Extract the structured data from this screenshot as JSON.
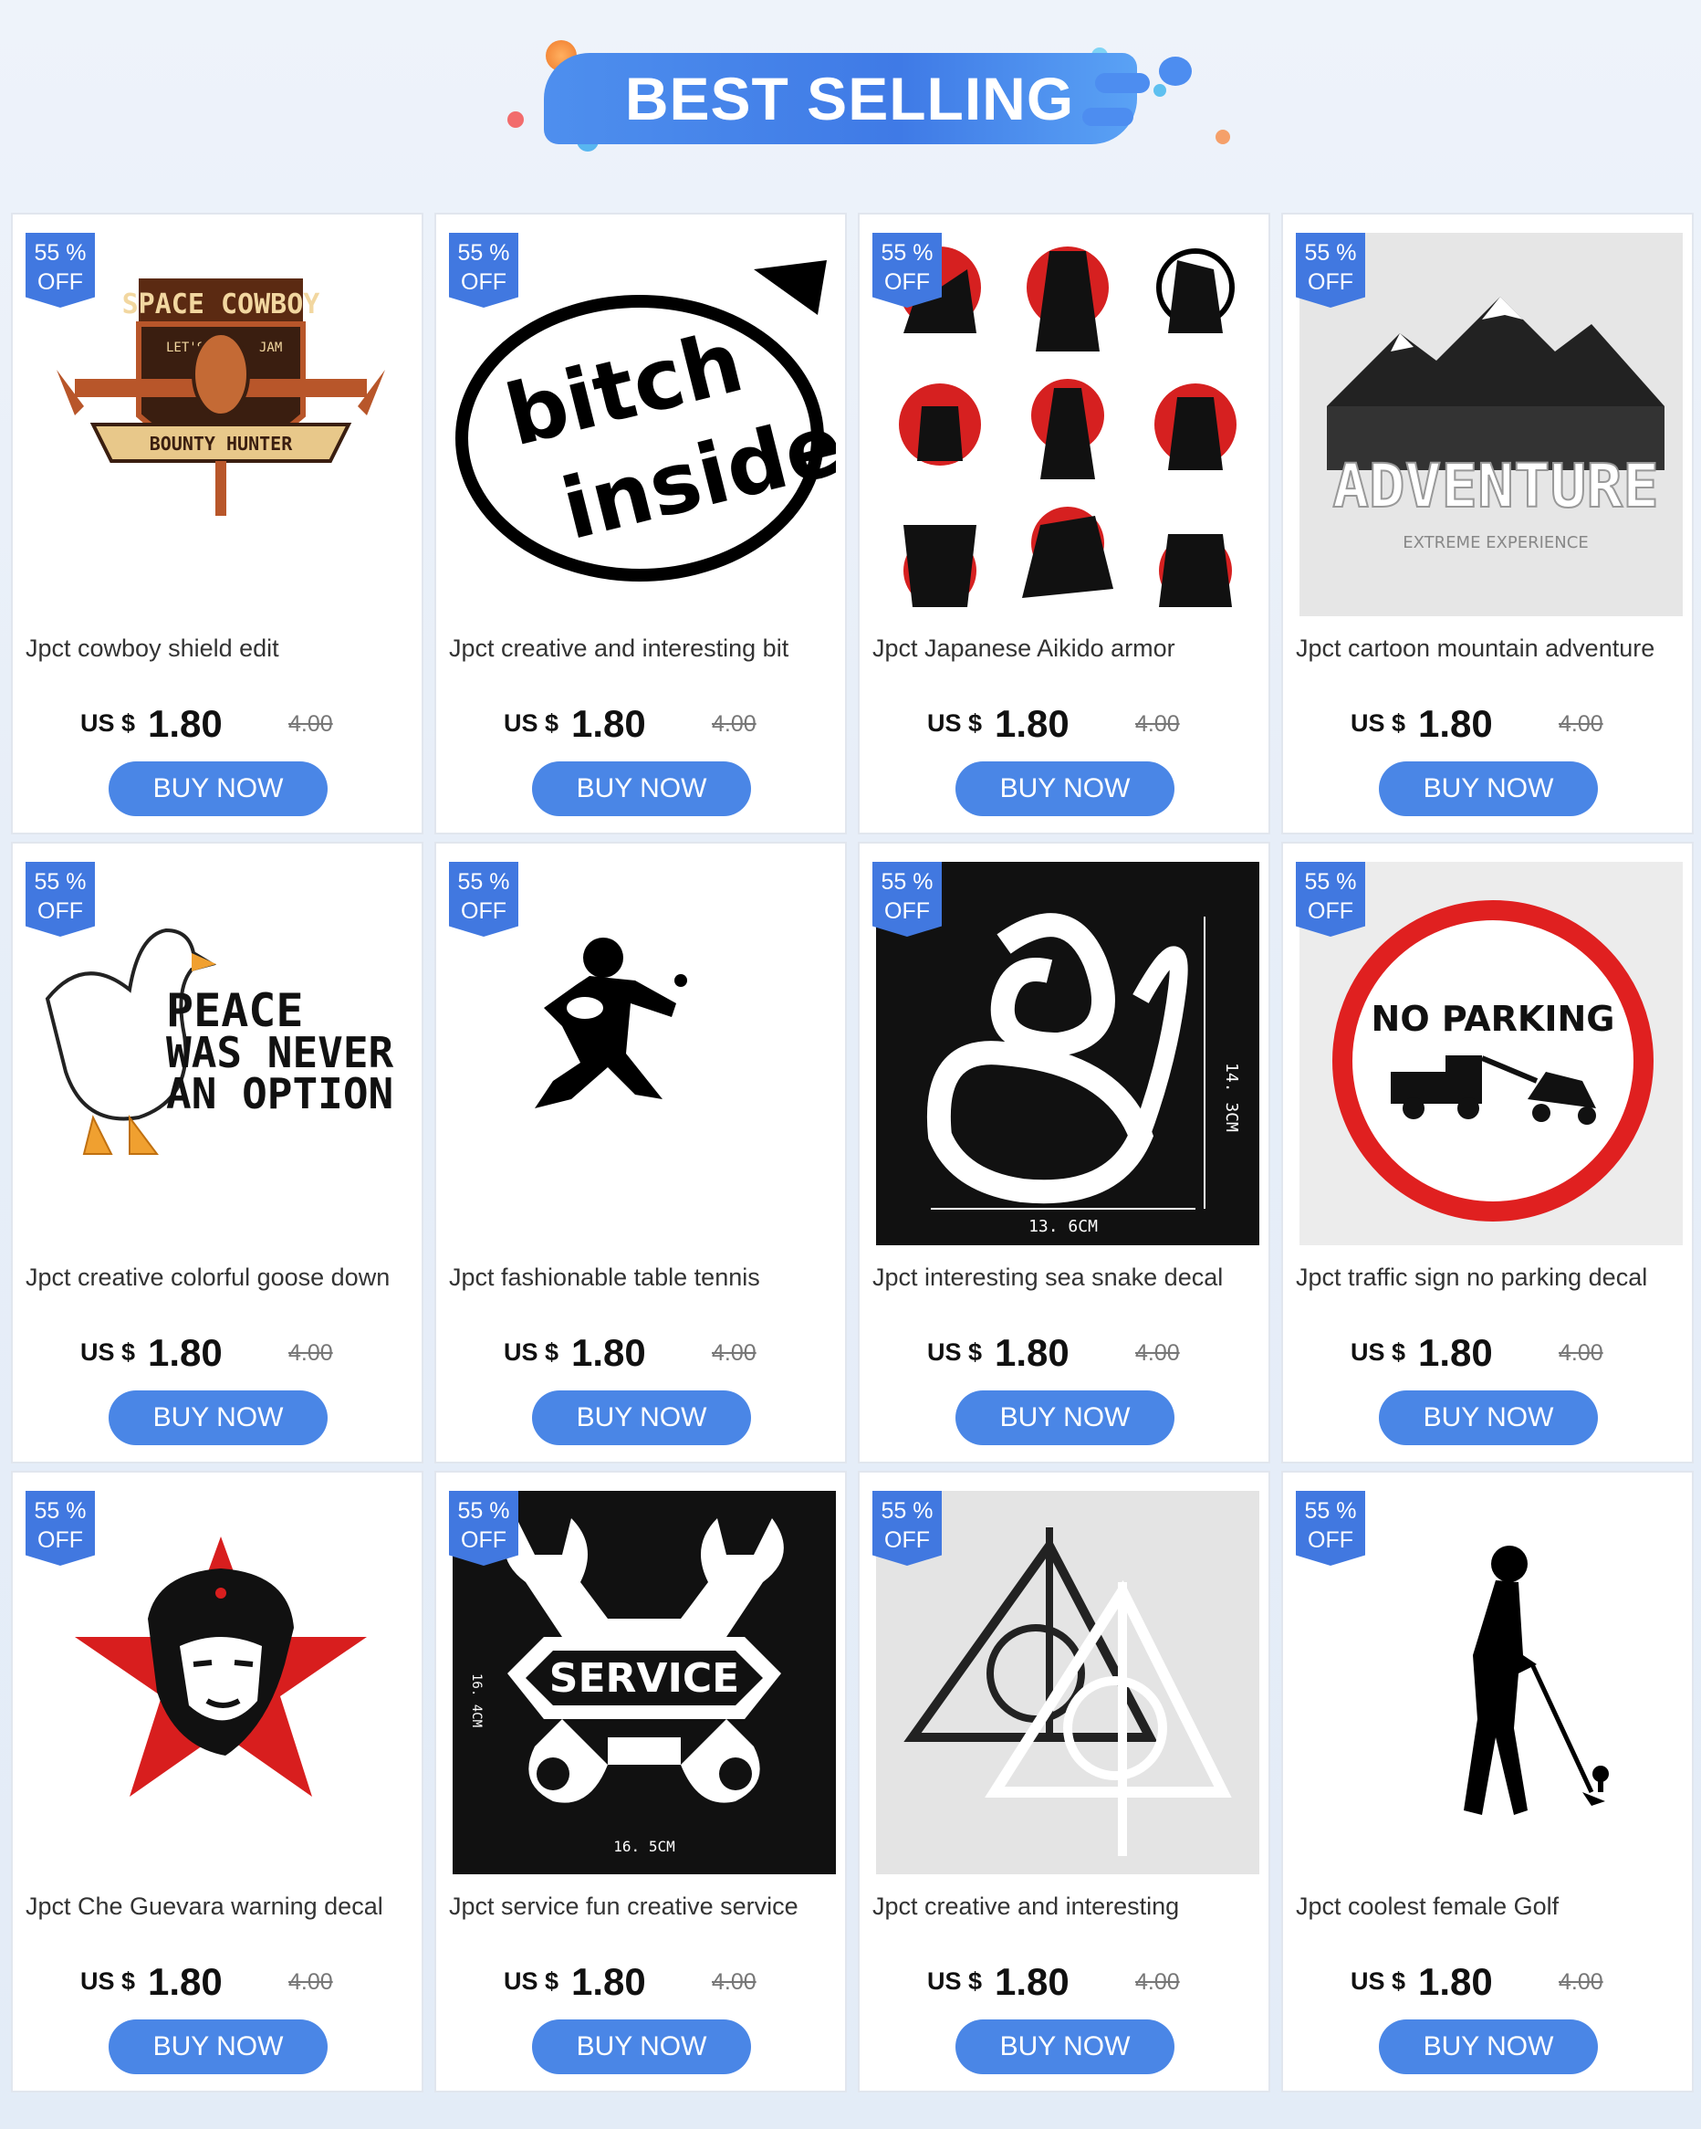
{
  "banner": {
    "title": "BEST SELLING"
  },
  "colors": {
    "accent": "#4a86e6",
    "badge": "#4178e0"
  },
  "products": [
    {
      "title": "Jpct cowboy shield edit",
      "badge_percent": "55 %",
      "badge_off": "OFF",
      "currency": "US $",
      "price": "1.80",
      "old_price": "4.00",
      "button": "BUY NOW",
      "image": "space-cowboy-shield-decal",
      "image_text": [
        "SPACE COWBOY",
        "LET'S",
        "JAM",
        "BOUNTY HUNTER"
      ]
    },
    {
      "title": "Jpct creative and interesting bit",
      "badge_percent": "55 %",
      "badge_off": "OFF",
      "currency": "US $",
      "price": "1.80",
      "old_price": "4.00",
      "button": "BUY NOW",
      "image": "circle-text-decal",
      "image_text": [
        "bitch",
        "inside"
      ]
    },
    {
      "title": "Jpct Japanese Aikido armor",
      "badge_percent": "55 %",
      "badge_off": "OFF",
      "currency": "US $",
      "price": "1.80",
      "old_price": "4.00",
      "button": "BUY NOW",
      "image": "samurai-collection-decal",
      "image_text": []
    },
    {
      "title": "Jpct cartoon mountain adventure",
      "badge_percent": "55 %",
      "badge_off": "OFF",
      "currency": "US $",
      "price": "1.80",
      "old_price": "4.00",
      "button": "BUY NOW",
      "image": "mountain-adventure-decal",
      "image_text": [
        "ADVENTURE",
        "EXTREME EXPERIENCE"
      ]
    },
    {
      "title": "Jpct creative colorful goose down",
      "badge_percent": "55 %",
      "badge_off": "OFF",
      "currency": "US $",
      "price": "1.80",
      "old_price": "4.00",
      "button": "BUY NOW",
      "image": "goose-decal",
      "image_text": [
        "PEACE",
        "WAS NEVER",
        "AN OPTION"
      ]
    },
    {
      "title": "Jpct fashionable table tennis",
      "badge_percent": "55 %",
      "badge_off": "OFF",
      "currency": "US $",
      "price": "1.80",
      "old_price": "4.00",
      "button": "BUY NOW",
      "image": "table-tennis-player-decal",
      "image_text": []
    },
    {
      "title": "Jpct interesting sea snake decal",
      "badge_percent": "55 %",
      "badge_off": "OFF",
      "currency": "US $",
      "price": "1.80",
      "old_price": "4.00",
      "button": "BUY NOW",
      "image": "sea-snake-decal",
      "image_text": [
        "14. 3CM",
        "13. 6CM"
      ]
    },
    {
      "title": "Jpct traffic sign no parking decal",
      "badge_percent": "55 %",
      "badge_off": "OFF",
      "currency": "US $",
      "price": "1.80",
      "old_price": "4.00",
      "button": "BUY NOW",
      "image": "no-parking-sign-decal",
      "image_text": [
        "NO PARKING"
      ]
    },
    {
      "title": "Jpct Che Guevara warning decal",
      "badge_percent": "55 %",
      "badge_off": "OFF",
      "currency": "US $",
      "price": "1.80",
      "old_price": "4.00",
      "button": "BUY NOW",
      "image": "che-guevara-star-decal",
      "image_text": []
    },
    {
      "title": "Jpct service fun creative service",
      "badge_percent": "55 %",
      "badge_off": "OFF",
      "currency": "US $",
      "price": "1.80",
      "old_price": "4.00",
      "button": "BUY NOW",
      "image": "service-wrench-decal",
      "image_text": [
        "SERVICE",
        "16. 4CM",
        "16. 5CM"
      ]
    },
    {
      "title": "Jpct creative and interesting",
      "badge_percent": "55 %",
      "badge_off": "OFF",
      "currency": "US $",
      "price": "1.80",
      "old_price": "4.00",
      "button": "BUY NOW",
      "image": "deathly-hallows-decal",
      "image_text": []
    },
    {
      "title": "Jpct coolest female Golf",
      "badge_percent": "55 %",
      "badge_off": "OFF",
      "currency": "US $",
      "price": "1.80",
      "old_price": "4.00",
      "button": "BUY NOW",
      "image": "female-golfer-decal",
      "image_text": []
    }
  ]
}
